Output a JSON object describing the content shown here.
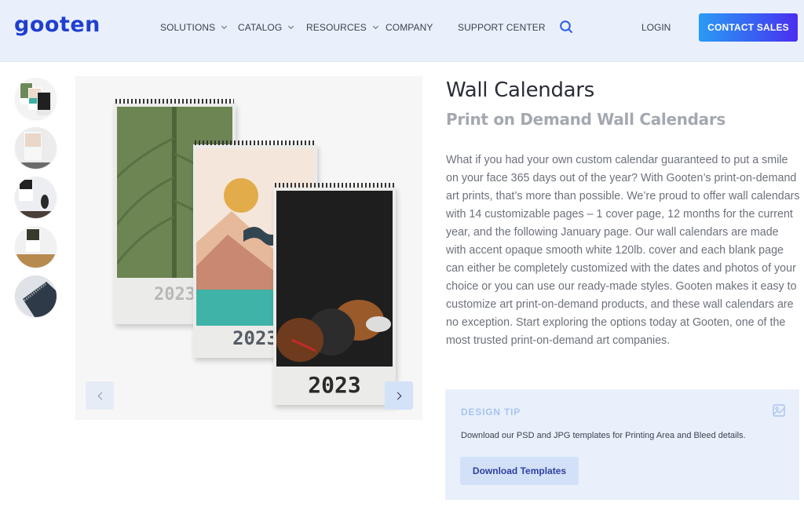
{
  "header": {
    "logo": "gooten",
    "nav": [
      {
        "label": "SOLUTIONS",
        "has_dropdown": true
      },
      {
        "label": "CATALOG",
        "has_dropdown": true
      },
      {
        "label": "RESOURCES",
        "has_dropdown": true
      },
      {
        "label": "COMPANY",
        "has_dropdown": false
      },
      {
        "label": "SUPPORT CENTER",
        "has_dropdown": false
      }
    ],
    "search_icon": "search-icon",
    "login": "LOGIN",
    "contact": "CONTACT SALES"
  },
  "gallery": {
    "thumbnails": [
      {
        "name": "three-calendars"
      },
      {
        "name": "marble-calendar"
      },
      {
        "name": "vase-calendar"
      },
      {
        "name": "shelf-calendar"
      },
      {
        "name": "spiral-closeup"
      }
    ],
    "calendars": [
      {
        "name": "leaf-calendar",
        "year": "2023"
      },
      {
        "name": "mountain-calendar",
        "year": "2023"
      },
      {
        "name": "dogs-calendar",
        "year": "2023"
      }
    ],
    "prev_icon": "chevron-left-icon",
    "next_icon": "chevron-right-icon"
  },
  "product": {
    "title": "Wall Calendars",
    "subtitle": "Print on Demand Wall Calendars",
    "description": "What if you had your own custom calendar guaranteed to put a smile on your face 365 days out of the year? With Gooten’s print-on-demand art prints, that’s more than possible. We’re proud to offer wall calendars with 14 customizable pages – 1 cover page, 12 months for the current year, and the following January page. Our wall calendars are made with accent opaque smooth white 120lb. cover and each blank page can either be completely customized with the dates and photos of your choice or you can use our ready-made styles.  Gooten makes it easy to customize art print-on-demand products, and these wall calendars are no exception. Start exploring the options today at Gooten, one of the most trusted print-on-demand art companies."
  },
  "design_tip": {
    "label": "DESIGN TIP",
    "icon": "image-icon",
    "text": "Download our PSD and JPG templates for Printing Area and Bleed details.",
    "button": "Download Templates"
  },
  "colors": {
    "brand": "#1f3fcf",
    "header_bg": "#e9f0fc",
    "accent_blue": "#3a5cf2"
  }
}
